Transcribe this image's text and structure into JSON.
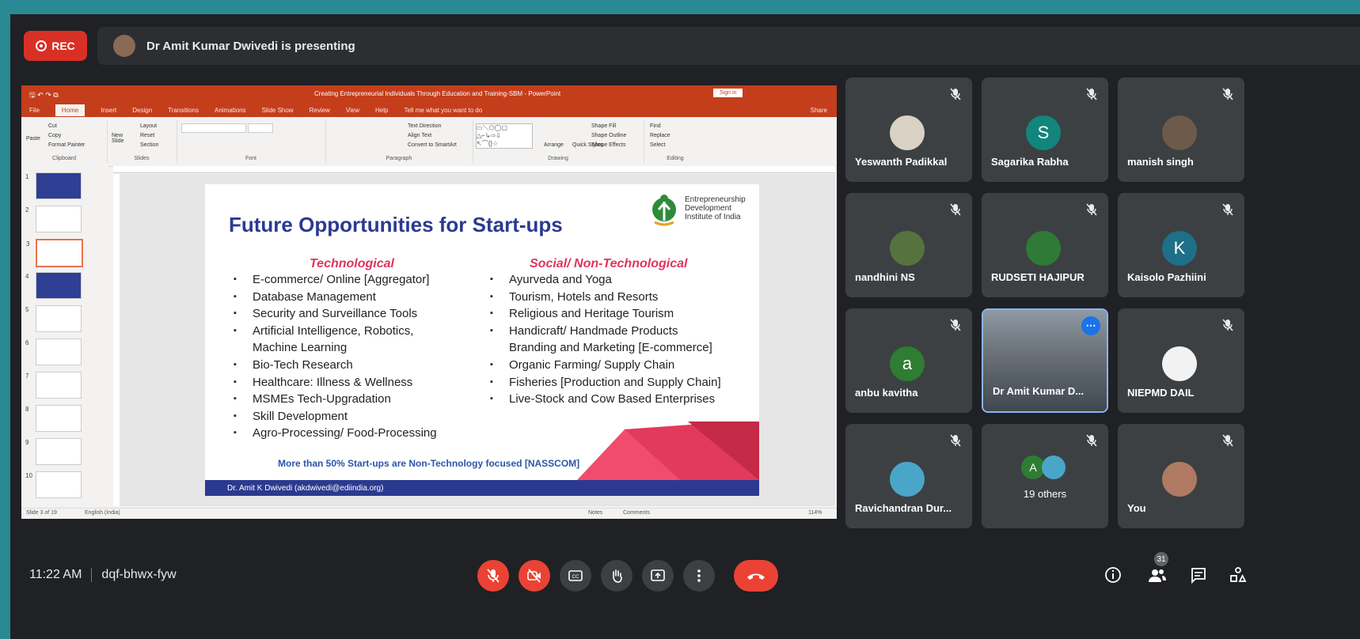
{
  "recording": {
    "label": "REC"
  },
  "presenting_banner": "Dr Amit Kumar Dwivedi is presenting",
  "powerpoint": {
    "window_title": "Creating Entrepreneurial Individuals Through Education and Training-SBM - PowerPoint",
    "signin_label": "Sign in",
    "menus": [
      "File",
      "Home",
      "Insert",
      "Design",
      "Transitions",
      "Animations",
      "Slide Show",
      "Review",
      "View",
      "Help",
      "Tell me what you want to do"
    ],
    "share_label": "Share",
    "ribbon_groups": [
      "Clipboard",
      "Slides",
      "Font",
      "Paragraph",
      "Drawing",
      "Editing"
    ],
    "ribbon_items": {
      "cut": "Cut",
      "copy": "Copy",
      "format_painter": "Format Painter",
      "paste": "Paste",
      "layout": "Layout",
      "reset": "Reset",
      "section": "Section",
      "new_slide": "New Slide",
      "find": "Find",
      "replace": "Replace",
      "select": "Select",
      "arrange": "Arrange",
      "quick_styles": "Quick Styles",
      "shape_fill": "Shape Fill",
      "shape_outline": "Shape Outline",
      "shape_effects": "Shape Effects",
      "text_direction": "Text Direction",
      "align_text": "Align Text",
      "convert": "Convert to SmartArt"
    },
    "thumbnails": [
      "1",
      "2",
      "3",
      "4",
      "5",
      "6",
      "7",
      "8",
      "9",
      "10"
    ],
    "status_left": "Slide 3 of 19",
    "status_lang": "English (India)",
    "notes_label": "Notes",
    "comments_label": "Comments",
    "zoom": "114%"
  },
  "slide": {
    "title": "Future Opportunities for Start-ups",
    "org_lines": [
      "Entrepreneurship",
      "Development",
      "Institute of India"
    ],
    "col1_heading": "Technological",
    "col2_heading": "Social/ Non-Technological",
    "col1_items": [
      {
        "text": "E-commerce/ Online [Aggregator]",
        "bullet": true
      },
      {
        "text": "Database Management",
        "bullet": true
      },
      {
        "text": "Security and Surveillance Tools",
        "bullet": true
      },
      {
        "text": "Artificial Intelligence, Robotics,",
        "bullet": true
      },
      {
        "text": "Machine Learning",
        "bullet": false
      },
      {
        "text": "Bio-Tech  Research",
        "bullet": true
      },
      {
        "text": "Healthcare: Illness & Wellness",
        "bullet": true
      },
      {
        "text": "MSMEs Tech-Upgradation",
        "bullet": true
      },
      {
        "text": "Skill Development",
        "bullet": true
      },
      {
        "text": "Agro-Processing/ Food-Processing",
        "bullet": true
      }
    ],
    "col2_items": [
      {
        "text": "Ayurveda and Yoga",
        "bullet": true
      },
      {
        "text": "Tourism, Hotels and Resorts",
        "bullet": true
      },
      {
        "text": "Religious and Heritage Tourism",
        "bullet": true
      },
      {
        "text": "Handicraft/ Handmade Products",
        "bullet": true
      },
      {
        "text": "Branding and Marketing [E-commerce]",
        "bullet": false
      },
      {
        "text": "Organic Farming/ Supply Chain",
        "bullet": true
      },
      {
        "text": "Fisheries [Production and Supply Chain]",
        "bullet": true
      },
      {
        "text": "Live-Stock and Cow Based Enterprises",
        "bullet": true
      }
    ],
    "note": "More than 50% Start-ups are Non-Technology focused  [NASSCOM]",
    "footer": "Dr. Amit K Dwivedi (akdwivedi@ediindia.org)"
  },
  "participants": [
    {
      "name": "Yeswanth Padikkal",
      "initial": "",
      "color": "#d9d2c4",
      "muted": true
    },
    {
      "name": "Sagarika Rabha",
      "initial": "S",
      "color": "#12857d",
      "muted": true
    },
    {
      "name": "manish singh",
      "initial": "",
      "color": "#6e5a4a",
      "muted": true
    },
    {
      "name": "nandhini NS",
      "initial": "",
      "color": "#56733f",
      "muted": true
    },
    {
      "name": "RUDSETI HAJIPUR",
      "initial": "",
      "color": "#2f7a36",
      "muted": true
    },
    {
      "name": "Kaisolo Pazhiini",
      "initial": "K",
      "color": "#1e6f88",
      "muted": true
    },
    {
      "name": "anbu kavitha",
      "initial": "a",
      "color": "#2e7d32",
      "muted": true
    },
    {
      "name": "Dr Amit Kumar D...",
      "initial": "",
      "color": "#7a6a5c",
      "muted": false
    },
    {
      "name": "NIEPMD DAIL",
      "initial": "",
      "color": "#f2f2f2",
      "muted": true
    },
    {
      "name": "Ravichandran Dur...",
      "initial": "",
      "color": "#4aa6c9",
      "muted": true
    },
    {
      "name": "19 others",
      "initial": "A",
      "color": "#2e7d32",
      "muted": true
    },
    {
      "name": "You",
      "initial": "",
      "color": "#b07a62",
      "muted": true
    }
  ],
  "bottom": {
    "time": "11:22 AM",
    "meeting_code": "dqf-bhwx-fyw",
    "people_count": "31"
  }
}
